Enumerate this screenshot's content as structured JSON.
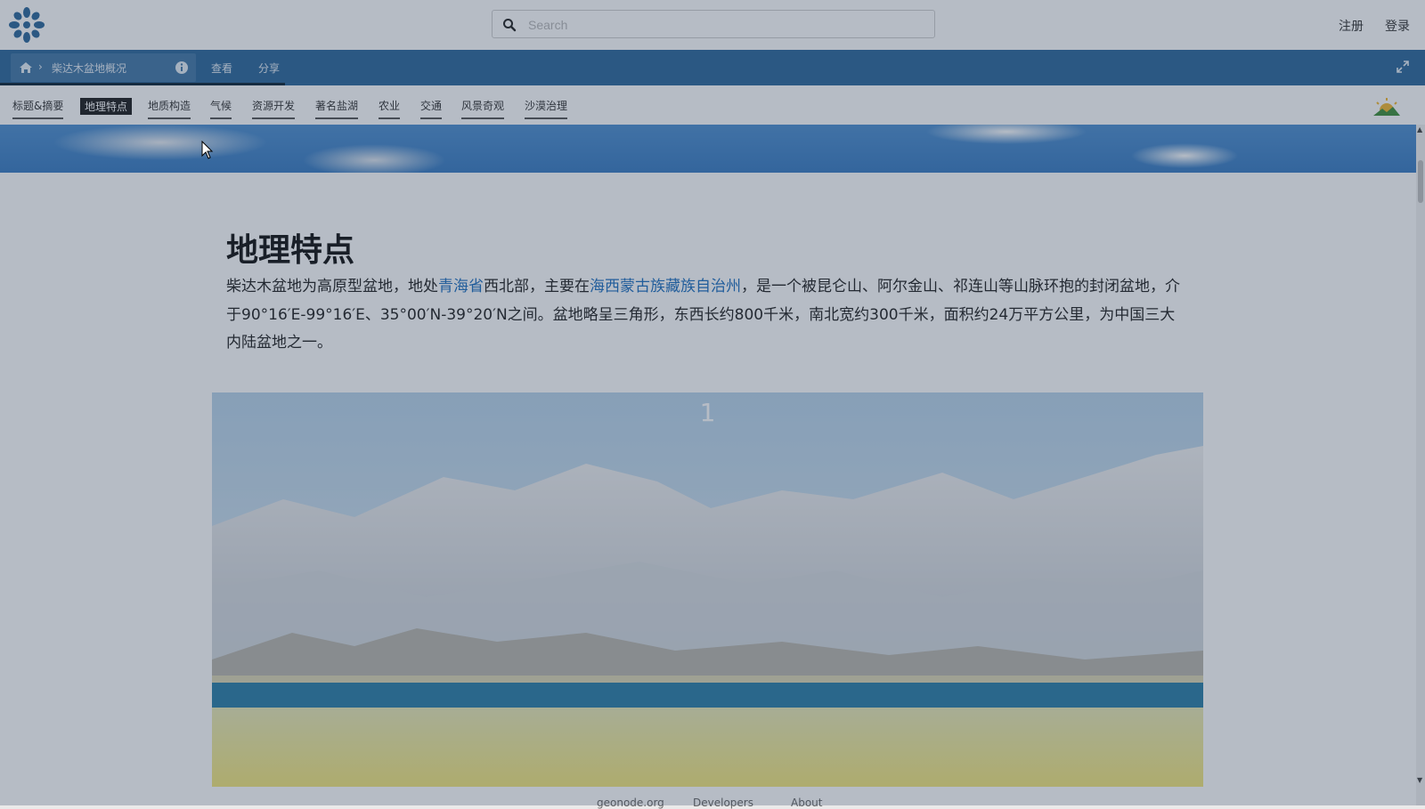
{
  "header": {
    "logo_icon": "geonode-logo-icon",
    "search_placeholder": "Search",
    "register_label": "注册",
    "login_label": "登录"
  },
  "navbar": {
    "breadcrumb_title": "柴达木盆地概况",
    "chevron": "›",
    "view_label": "查看",
    "share_label": "分享",
    "progress_fraction": 0.2
  },
  "tabs": [
    {
      "label": "标题&摘要",
      "active": false
    },
    {
      "label": "地理特点",
      "active": true
    },
    {
      "label": "地质构造",
      "active": false
    },
    {
      "label": "气候",
      "active": false
    },
    {
      "label": "资源开发",
      "active": false
    },
    {
      "label": "著名盐湖",
      "active": false
    },
    {
      "label": "农业",
      "active": false
    },
    {
      "label": "交通",
      "active": false
    },
    {
      "label": "风景奇观",
      "active": false
    },
    {
      "label": "沙漠治理",
      "active": false
    }
  ],
  "section": {
    "title": "地理特点",
    "para_part1": "柴达木盆地为高原型盆地，地处",
    "link1": "青海省",
    "para_part2": "西北部，主要在",
    "link2": "海西蒙古族藏族自治州",
    "para_part3": "，是一个被昆仑山、阿尔金山、祁连山等山脉环抱的封闭盆地，介于90°16′E-99°16′E、35°00′N-39°20′N之间。盆地略呈三角形，东西长约800千米，南北宽约300千米，面积约24万平方公里，为中国三大内陆盆地之一。"
  },
  "photo": {
    "number": "1"
  },
  "footer": {
    "link1": "geonode.org",
    "link2": "Developers",
    "link3": "About"
  },
  "colors": {
    "nav_blue": "#2c689c",
    "link_blue": "#1e6fc0",
    "overlay": "#283c55"
  }
}
